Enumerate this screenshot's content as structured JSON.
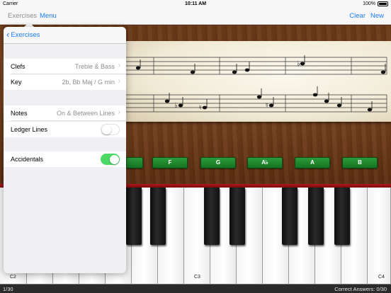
{
  "status": {
    "carrier": "Carrier",
    "time": "10:11 AM",
    "battery": "100%"
  },
  "nav": {
    "exercises": "Exercises",
    "menu": "Menu",
    "clear": "Clear",
    "new": "New"
  },
  "popover": {
    "back_label": "Exercises",
    "rows": {
      "clefs": {
        "label": "Clefs",
        "value": "Treble & Bass"
      },
      "key": {
        "label": "Key",
        "value": "2b, Bb Maj / G min"
      },
      "notes": {
        "label": "Notes",
        "value": "On & Between Lines"
      },
      "ledger": {
        "label": "Ledger Lines",
        "on": false
      },
      "accidentals": {
        "label": "Accidentals",
        "on": true
      }
    }
  },
  "note_buttons": [
    "F",
    "G",
    "A♭",
    "A",
    "B"
  ],
  "key_labels": {
    "c2": "C2",
    "c3": "C3",
    "c4": "C4"
  },
  "bottom": {
    "progress": "1/30",
    "answers": "Correct Answers:  0/30"
  },
  "colors": {
    "accent": "#1b7cf5",
    "toggle_on": "#4cd964",
    "note_button": "#1e8a2e"
  }
}
